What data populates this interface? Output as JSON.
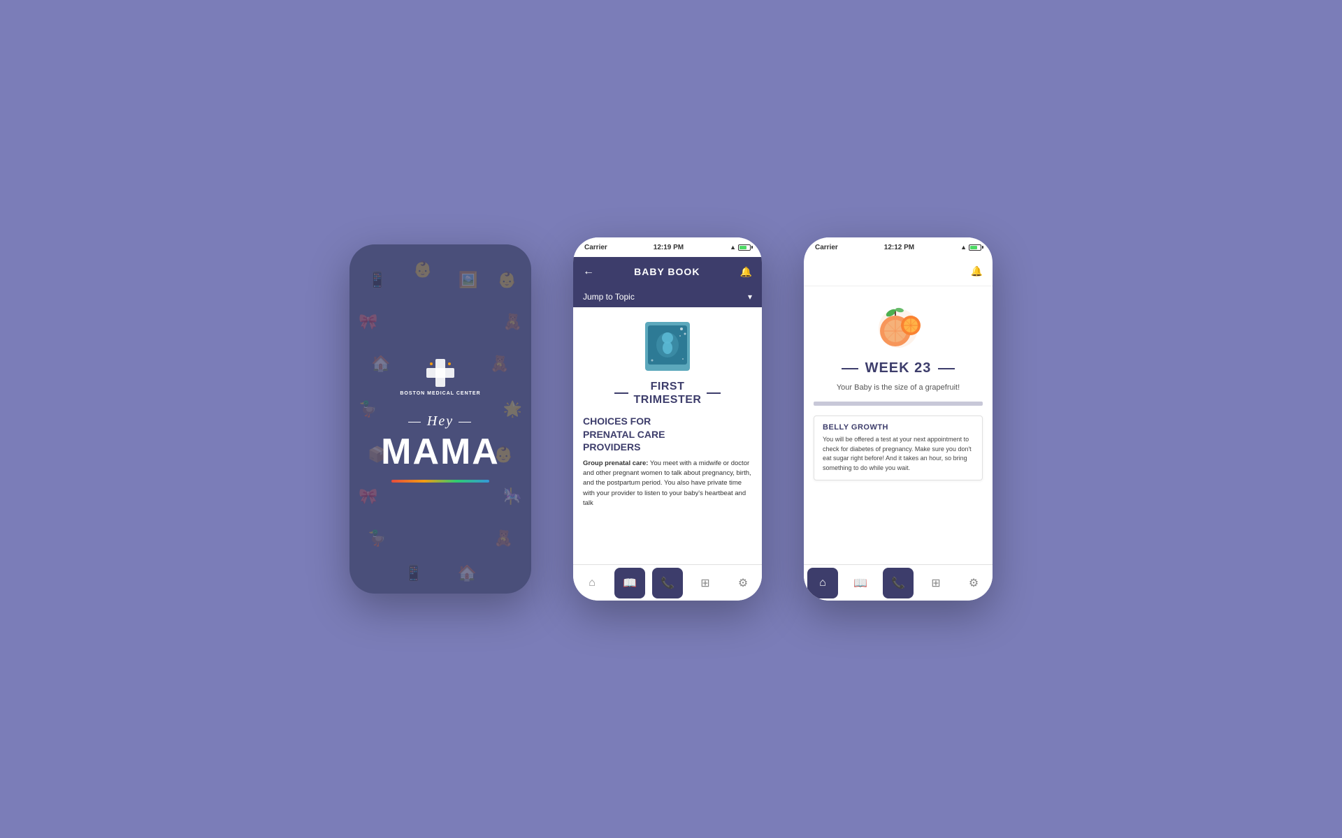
{
  "background": "#7b7db8",
  "phone1": {
    "brand": "BOSTON\nMEDICAL\nCENTER",
    "hey": "Hey",
    "mama": "MAMA"
  },
  "phone2": {
    "status_bar": {
      "carrier": "Carrier",
      "time": "12:19 PM"
    },
    "header": {
      "title": "BABY BOOK",
      "back": "←",
      "bell": "🔔"
    },
    "jump_to_topic": "Jump to Topic",
    "section": {
      "title": "FIRST\nTRIMESTER",
      "content_heading": "CHOICES FOR\nPRENATAL CARE\nPROVIDERS",
      "content_body_bold": "Group prenatal care:",
      "content_body": "You meet with a midwife or doctor and other pregnant women to talk about pregnancy, birth, and the postpartum period. You also have private time with your provider to listen to your baby's heartbeat and talk"
    },
    "nav": [
      "home",
      "book",
      "phone",
      "calendar",
      "settings"
    ]
  },
  "phone3": {
    "status_bar": {
      "carrier": "Carrier",
      "time": "12:12 PM"
    },
    "week": {
      "number": "23",
      "label": "WEEK 23",
      "subtitle": "Your Baby is the size of a grapefruit!"
    },
    "card": {
      "heading": "BELLY GROWTH",
      "body": "You will be offered a test at your next appointment to check for diabetes of pregnancy. Make sure you don't eat sugar right before! And it takes an hour, so bring something to do while you wait."
    },
    "nav": [
      "home",
      "book",
      "phone",
      "calendar",
      "settings"
    ]
  }
}
